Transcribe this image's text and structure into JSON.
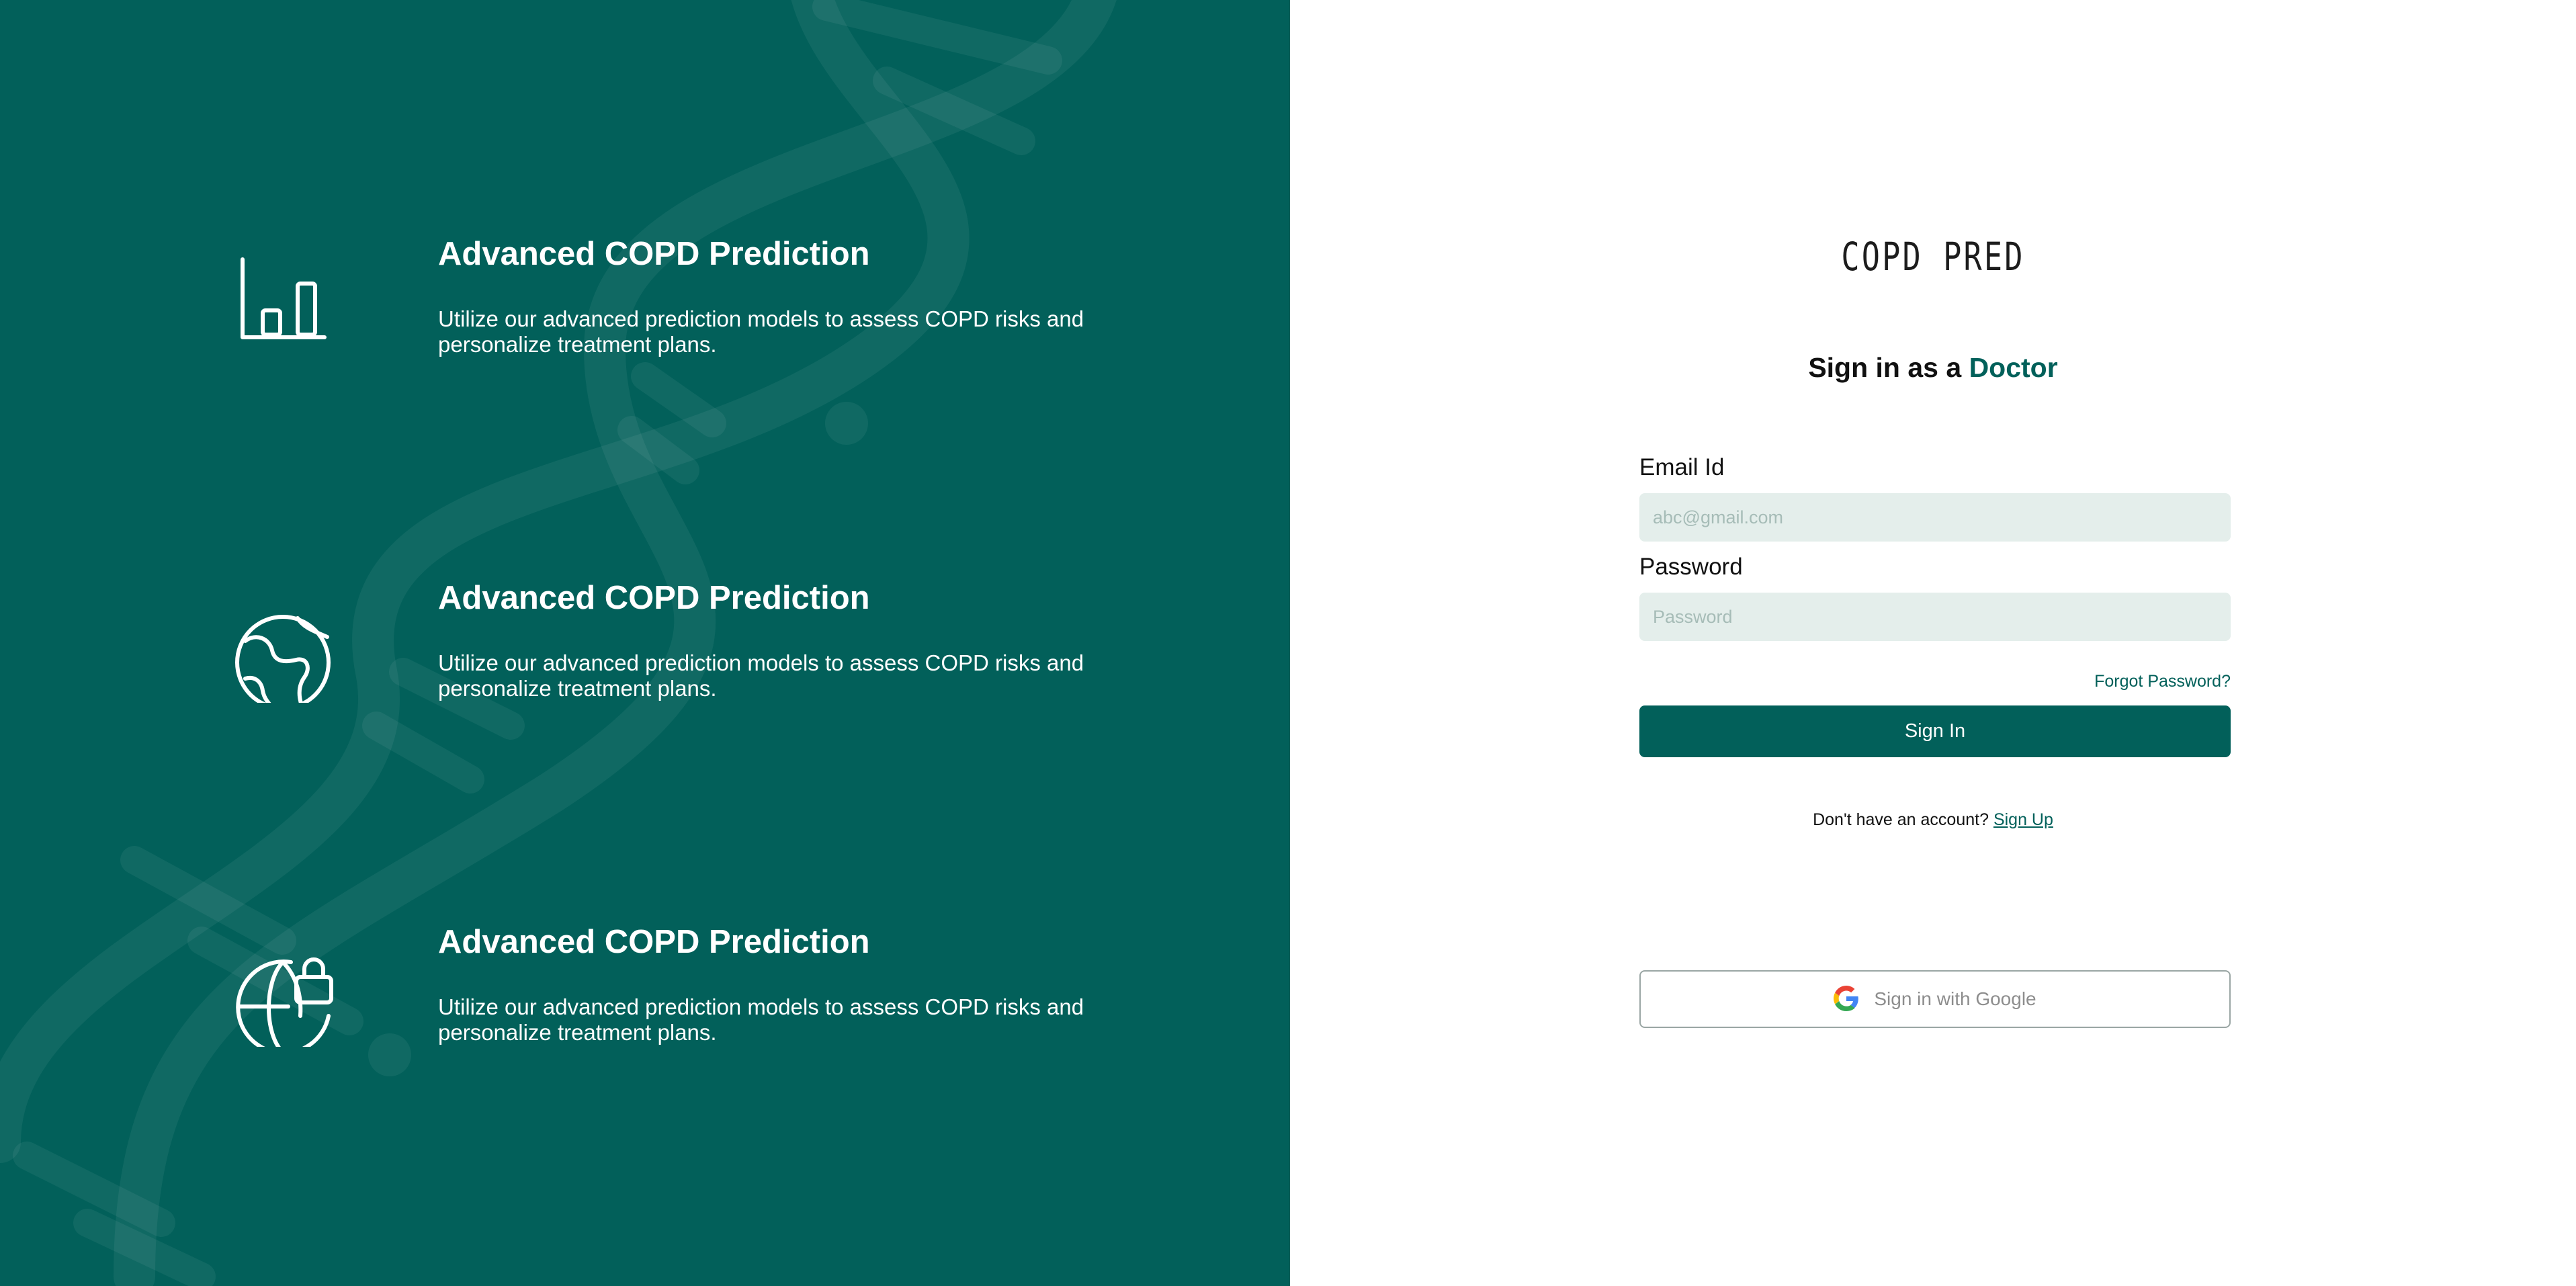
{
  "left_panel": {
    "features": [
      {
        "icon": "bar-chart-icon",
        "title": "Advanced COPD Prediction",
        "description": "Utilize our advanced prediction models to assess COPD risks and personalize treatment plans."
      },
      {
        "icon": "globe-icon",
        "title": "Advanced COPD Prediction",
        "description": "Utilize our advanced prediction models to assess COPD risks and personalize treatment plans."
      },
      {
        "icon": "globe-lock-icon",
        "title": "Advanced COPD Prediction",
        "description": "Utilize our advanced prediction models to assess COPD risks and personalize treatment plans."
      }
    ]
  },
  "login": {
    "brand": "COPD PRED",
    "heading_prefix": "Sign in as a",
    "heading_role": "Doctor",
    "email_label": "Email Id",
    "email_placeholder": "abc@gmail.com",
    "email_value": "",
    "password_label": "Password",
    "password_placeholder": "Password",
    "password_value": "",
    "forgot_password": "Forgot Password?",
    "signin_button": "Sign In",
    "no_account_text": "Don't have an account?",
    "signup_link": "Sign Up",
    "google_button": "Sign in with Google"
  },
  "colors": {
    "primary": "#02605a",
    "input_bg": "#e4eeeb",
    "page_bg": "#ffffff"
  }
}
